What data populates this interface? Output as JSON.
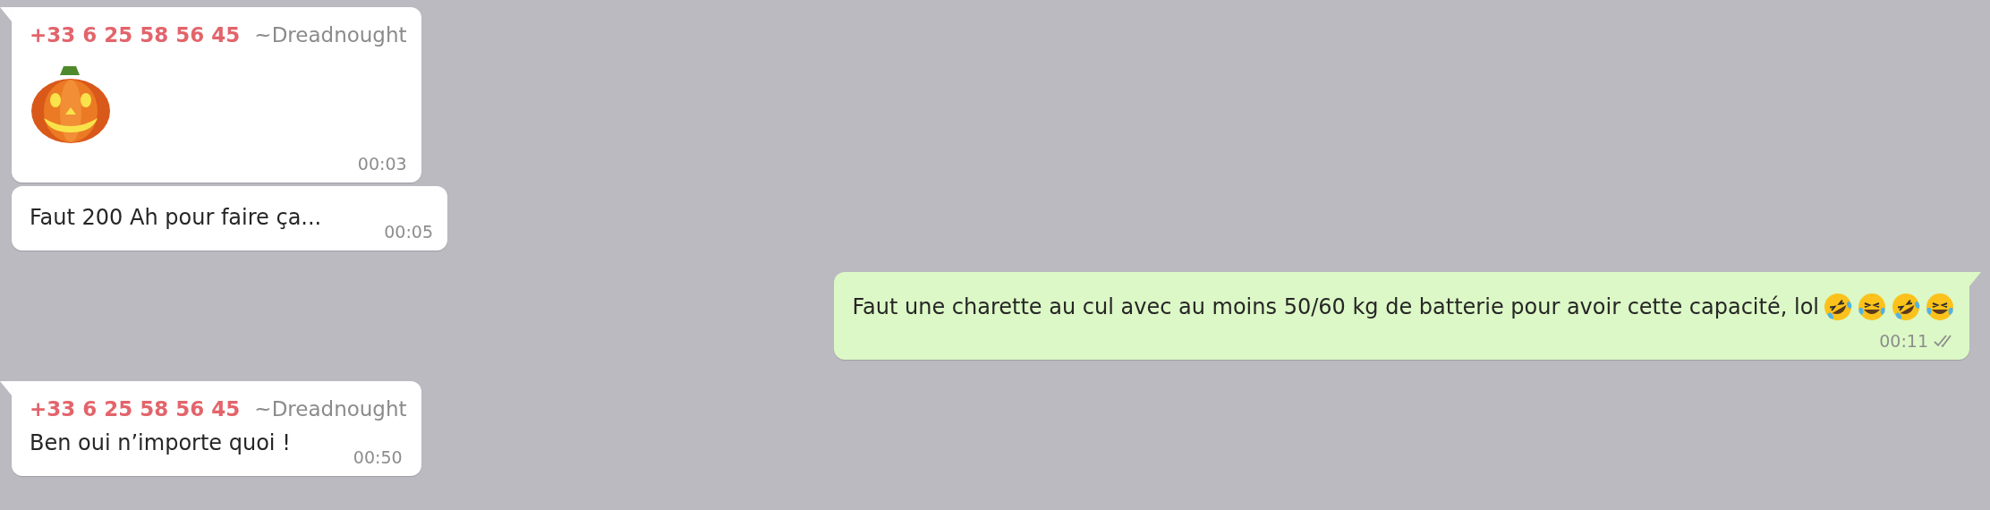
{
  "messages": [
    {
      "kind": "incoming",
      "tail": true,
      "sender": {
        "phone": "+33 6 25 58 56 45",
        "name": "~Dreadnought"
      },
      "emoji": {
        "kind": "pumpkin"
      },
      "time": "00:03"
    },
    {
      "kind": "incoming",
      "tail": false,
      "text": "Faut 200 Ah pour faire ça...",
      "time": "00:05"
    },
    {
      "kind": "outgoing",
      "tail": true,
      "text": "Faut une charette au cul avec au moins 50/60 kg de batterie pour avoir cette capacité, lol",
      "emojis": [
        {
          "kind": "rolling"
        },
        {
          "kind": "tears"
        },
        {
          "kind": "rolling"
        },
        {
          "kind": "tears"
        }
      ],
      "time": "00:11",
      "read": false
    },
    {
      "kind": "incoming",
      "tail": true,
      "sender": {
        "phone": "+33 6 25 58 56 45",
        "name": "~Dreadnought"
      },
      "text": "Ben oui n’importe quoi !",
      "time": "00:50"
    }
  ]
}
